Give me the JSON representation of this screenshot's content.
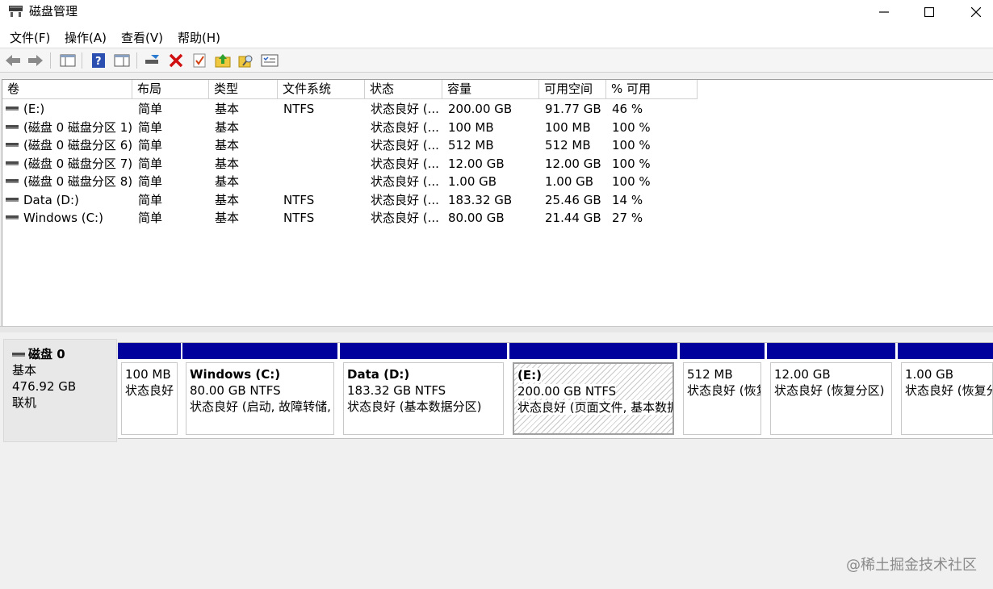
{
  "window": {
    "title": "磁盘管理",
    "app_icon": "disk-management-icon"
  },
  "menu": [
    {
      "label": "文件(F)"
    },
    {
      "label": "操作(A)"
    },
    {
      "label": "查看(V)"
    },
    {
      "label": "帮助(H)"
    }
  ],
  "toolbar": [
    "back-arrow-icon",
    "forward-arrow-icon",
    "console-tree-icon",
    "help-icon",
    "properties-pane-icon",
    "connect-drive-icon",
    "delete-icon",
    "check-icon",
    "up-folder-icon",
    "search-folder-icon",
    "properties-icon"
  ],
  "columns": [
    "卷",
    "布局",
    "类型",
    "文件系统",
    "状态",
    "容量",
    "可用空间",
    "% 可用"
  ],
  "volumes": [
    {
      "name": "(E:)",
      "layout": "简单",
      "type": "基本",
      "fs": "NTFS",
      "status": "状态良好 (...",
      "capacity": "200.00 GB",
      "free": "91.77 GB",
      "pct": "46 %"
    },
    {
      "name": "(磁盘 0 磁盘分区 1)",
      "layout": "简单",
      "type": "基本",
      "fs": "",
      "status": "状态良好 (...",
      "capacity": "100 MB",
      "free": "100 MB",
      "pct": "100 %"
    },
    {
      "name": "(磁盘 0 磁盘分区 6)",
      "layout": "简单",
      "type": "基本",
      "fs": "",
      "status": "状态良好 (...",
      "capacity": "512 MB",
      "free": "512 MB",
      "pct": "100 %"
    },
    {
      "name": "(磁盘 0 磁盘分区 7)",
      "layout": "简单",
      "type": "基本",
      "fs": "",
      "status": "状态良好 (...",
      "capacity": "12.00 GB",
      "free": "12.00 GB",
      "pct": "100 %"
    },
    {
      "name": "(磁盘 0 磁盘分区 8)",
      "layout": "简单",
      "type": "基本",
      "fs": "",
      "status": "状态良好 (...",
      "capacity": "1.00 GB",
      "free": "1.00 GB",
      "pct": "100 %"
    },
    {
      "name": "Data (D:)",
      "layout": "简单",
      "type": "基本",
      "fs": "NTFS",
      "status": "状态良好 (...",
      "capacity": "183.32 GB",
      "free": "25.46 GB",
      "pct": "14 %"
    },
    {
      "name": "Windows (C:)",
      "layout": "简单",
      "type": "基本",
      "fs": "NTFS",
      "status": "状态良好 (...",
      "capacity": "80.00 GB",
      "free": "21.44 GB",
      "pct": "27 %"
    }
  ],
  "disk": {
    "name": "磁盘 0",
    "type": "基本",
    "size": "476.92 GB",
    "state": "联机"
  },
  "partitions": [
    {
      "title": "",
      "line1": "100 MB",
      "line2": "状态良好"
    },
    {
      "title": "Windows  (C:)",
      "line1": "80.00 GB NTFS",
      "line2": "状态良好 (启动, 故障转储, 基本数据分区)"
    },
    {
      "title": "Data  (D:)",
      "line1": "183.32 GB NTFS",
      "line2": "状态良好 (基本数据分区)"
    },
    {
      "title": "(E:)",
      "line1": "200.00 GB NTFS",
      "line2": "状态良好 (页面文件, 基本数据分区)"
    },
    {
      "title": "",
      "line1": "512 MB",
      "line2": "状态良好 (恢复分区)"
    },
    {
      "title": "",
      "line1": "12.00 GB",
      "line2": "状态良好 (恢复分区)"
    },
    {
      "title": "",
      "line1": "1.00 GB",
      "line2": "状态良好 (恢复分区)"
    }
  ],
  "watermark": "@稀土掘金技术社区"
}
